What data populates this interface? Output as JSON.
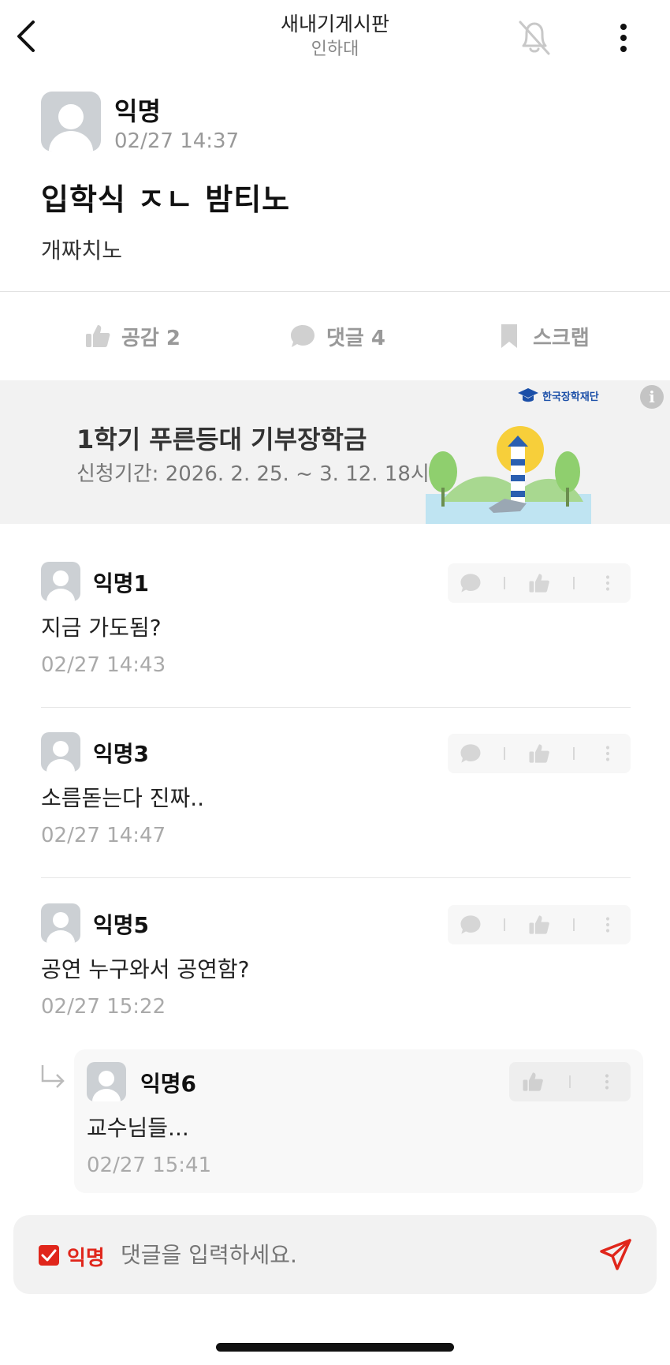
{
  "header": {
    "title": "새내기게시판",
    "subtitle": "인하대",
    "icons": {
      "back": "chevron-left-icon",
      "notifications": "bell-off-icon",
      "more": "more-vertical-icon"
    }
  },
  "post": {
    "author": "익명",
    "time": "02/27 14:37",
    "title": "입학식 ㅈㄴ 밤티노",
    "body": "개짜치노"
  },
  "actions": {
    "like_label": "공감 2",
    "comment_label": "댓글 4",
    "scrap_label": "스크랩"
  },
  "banner": {
    "title": "1학기 푸른등대 기부장학금",
    "subtitle": "신청기간: 2026. 2. 25. ~ 3. 12. 18시",
    "logo_text": "한국장학재단",
    "info_symbol": "i"
  },
  "comments": [
    {
      "author": "익명1",
      "text": "지금 가도됨?",
      "time": "02/27 14:43"
    },
    {
      "author": "익명3",
      "text": "소름돋는다 진짜..",
      "time": "02/27 14:47"
    },
    {
      "author": "익명5",
      "text": "공연 누구와서 공연함?",
      "time": "02/27 15:22"
    }
  ],
  "reply": {
    "author": "익명6",
    "text": "교수님들...",
    "time": "02/27 15:41"
  },
  "composer": {
    "anon_label": "익명",
    "anon_checked": true,
    "placeholder": "댓글을 입력하세요."
  },
  "colors": {
    "accent_red": "#e0261b",
    "muted_text": "#999999",
    "banner_bg": "#f2f2f2",
    "logo_blue": "#1b4fa8"
  }
}
